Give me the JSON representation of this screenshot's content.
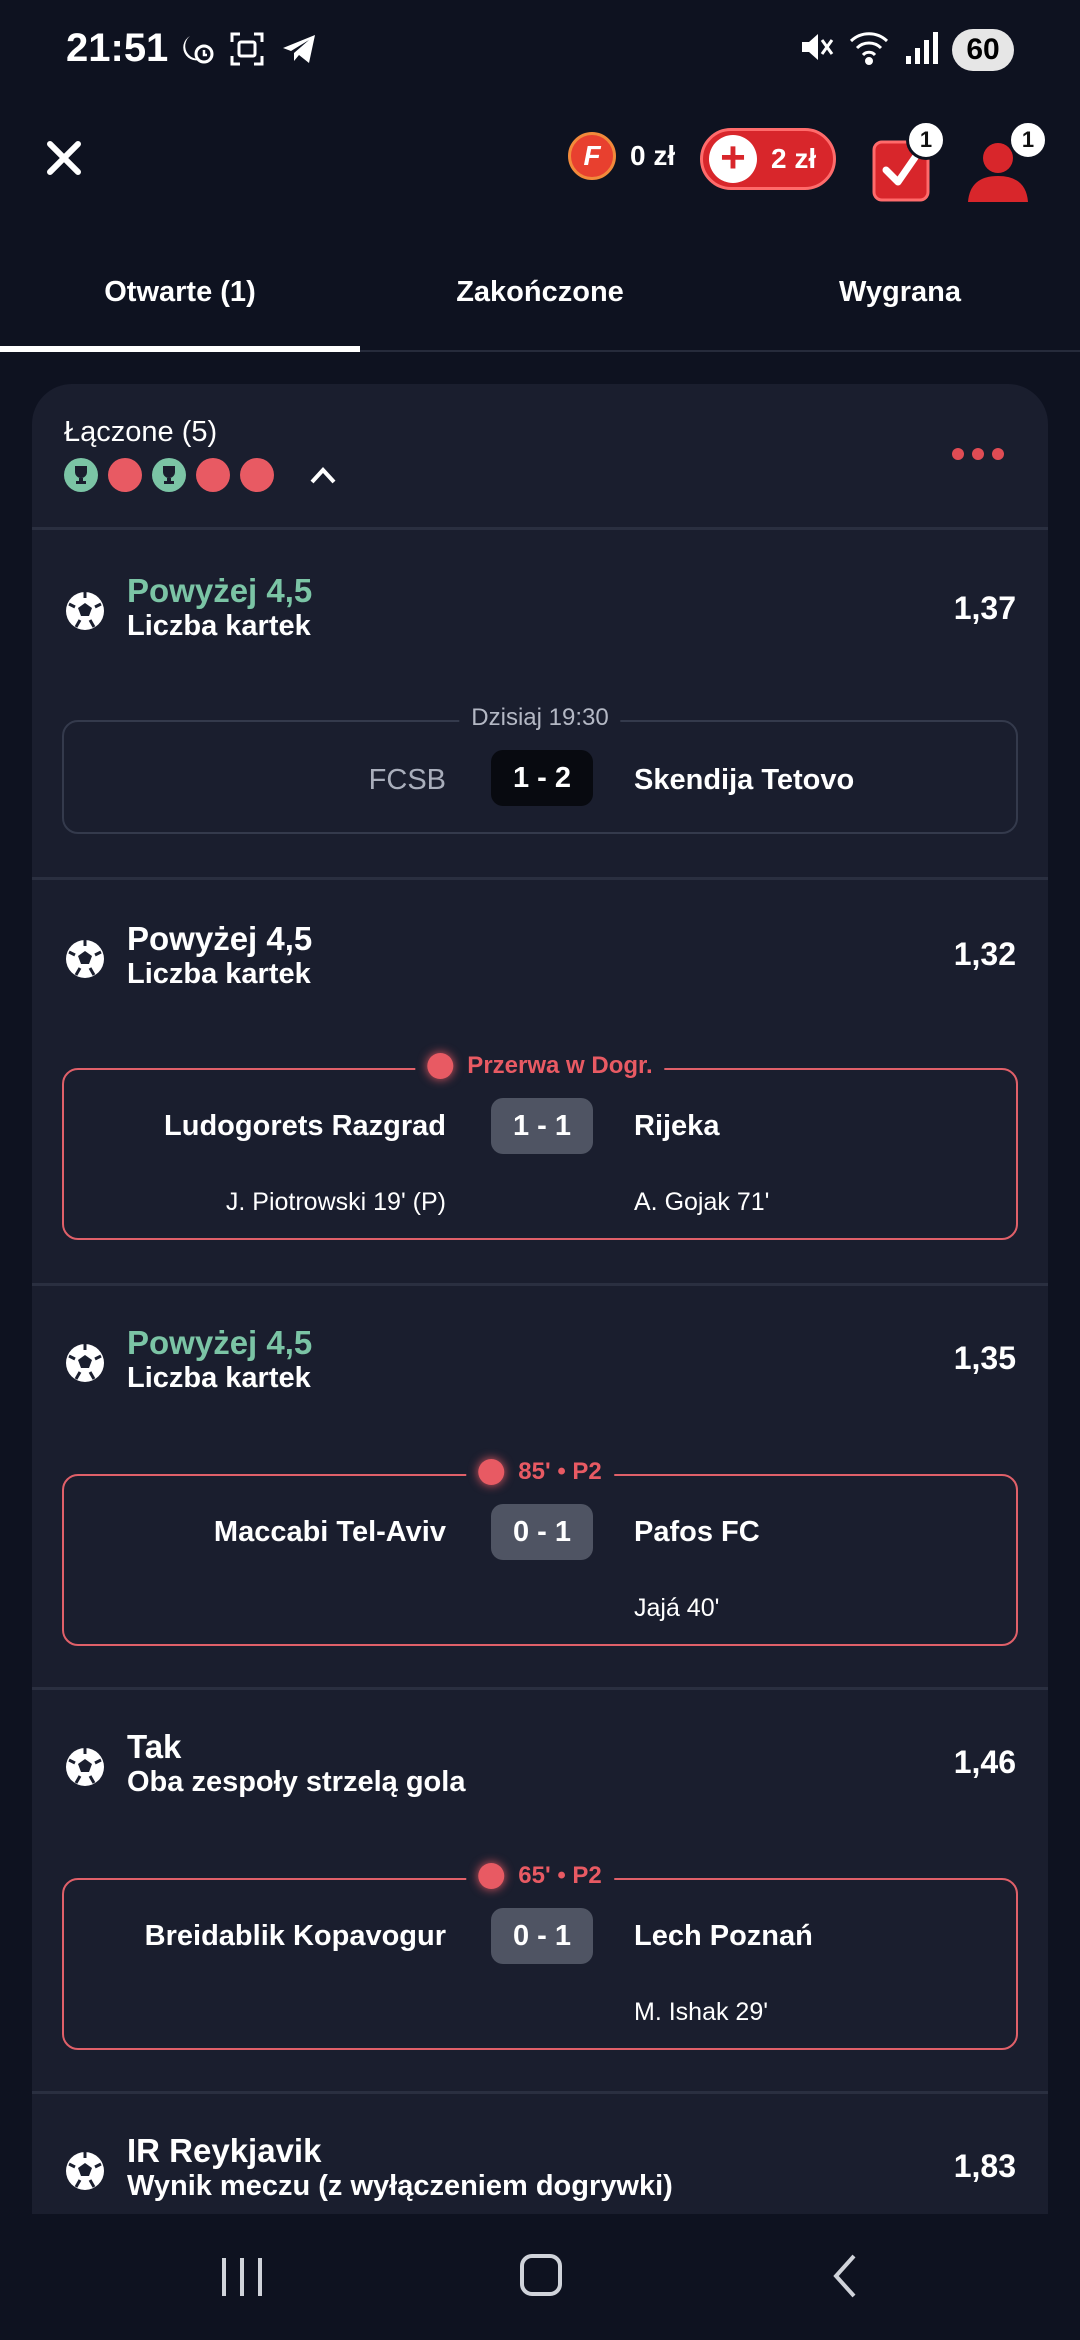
{
  "status_bar": {
    "time": "21:51",
    "battery": "60",
    "left_icons": [
      "moon-alarm-icon",
      "screenshot-icon",
      "telegram-icon"
    ],
    "right_icons": [
      "mute-icon",
      "wifi-icon",
      "signal-icon"
    ]
  },
  "header": {
    "coin_letter": "F",
    "coin_amount": "0 zł",
    "deposit_label": "2 zł",
    "betslip_badge": "1",
    "account_badge": "1",
    "colors": {
      "accent": "#d8262b",
      "won": "#7bc4a5",
      "live": "#e85a63"
    }
  },
  "tabs": [
    {
      "label": "Otwarte (1)",
      "active": true
    },
    {
      "label": "Zakończone",
      "active": false
    },
    {
      "label": "Wygrana",
      "active": false
    }
  ],
  "bet": {
    "title": "Łączone (5)",
    "legs_status": [
      "won",
      "live",
      "won",
      "live",
      "live"
    ],
    "selections": [
      {
        "name": "Powyżej 4,5",
        "market": "Liczba kartek",
        "odds": "1,37",
        "won": true,
        "match": {
          "status": "Dzisiaj 19:30",
          "live": false,
          "home": "FCSB",
          "score": "1 - 2",
          "away": "Skendija Tetovo",
          "home_scorer": "",
          "away_scorer": ""
        }
      },
      {
        "name": "Powyżej 4,5",
        "market": "Liczba kartek",
        "odds": "1,32",
        "won": false,
        "match": {
          "status": "Przerwa w Dogr.",
          "live": true,
          "home": "Ludogorets Razgrad",
          "score": "1 - 1",
          "away": "Rijeka",
          "home_scorer": "J. Piotrowski 19' (P)",
          "away_scorer": "A. Gojak 71'"
        }
      },
      {
        "name": "Powyżej 4,5",
        "market": "Liczba kartek",
        "odds": "1,35",
        "won": true,
        "match": {
          "status": "85' • P2",
          "live": true,
          "home": "Maccabi Tel-Aviv",
          "score": "0 - 1",
          "away": "Pafos FC",
          "home_scorer": "",
          "away_scorer": "Jajá 40'"
        }
      },
      {
        "name": "Tak",
        "market": "Oba zespoły strzelą gola",
        "odds": "1,46",
        "won": false,
        "match": {
          "status": "65' • P2",
          "live": true,
          "home": "Breidablik Kopavogur",
          "score": "0 - 1",
          "away": "Lech Poznań",
          "home_scorer": "",
          "away_scorer": "M. Ishak 29'"
        }
      },
      {
        "name": "IR Reykjavik",
        "market": "Wynik meczu (z wyłączeniem dogrywki)",
        "odds": "1,83",
        "won": false
      }
    ]
  }
}
